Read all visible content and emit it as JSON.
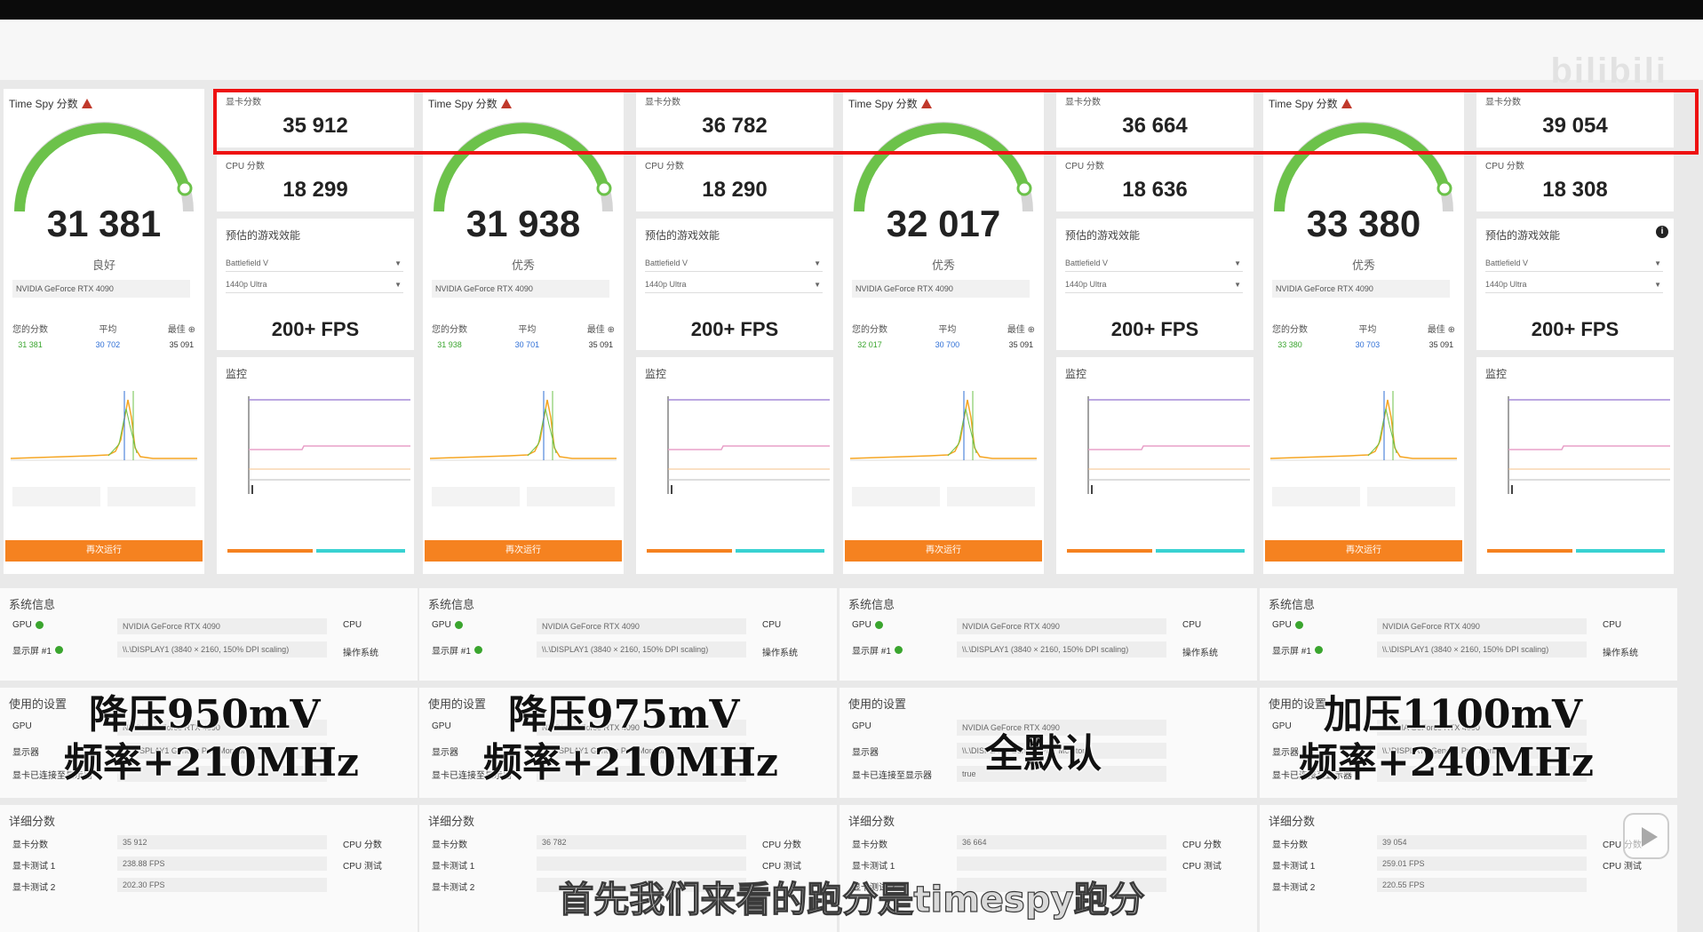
{
  "watermark": "bilibili",
  "gauge_title": "Time Spy 分数",
  "gpu_score_label": "显卡分数",
  "cpu_score_label": "CPU 分数",
  "perf_title": "预估的游戏效能",
  "game": "Battlefield V",
  "resolution": "1440p Ultra",
  "monitor_title": "监控",
  "system_title": "系统信息",
  "used_title": "使用的设置",
  "detail_title": "详细分数",
  "gpu_model": "NVIDIA GeForce RTX 4090",
  "display": "\\\\.\\DISPLAY1 (3840 × 2160, 150% DPI scaling)",
  "monitor_name": "\\\\.\\DISPLAY1 Generic PnP Monitor",
  "compare_label": "您的分数",
  "avg_label": "平均",
  "best_label": "最佳",
  "best_value": "35 091",
  "run_button": "再次运行",
  "columns": [
    {
      "score": "31 381",
      "rating": "良好",
      "yours": "31 381",
      "avg": "30 702",
      "gpu_score": "35 912",
      "cpu_score": "18 299",
      "fps": "200+ FPS",
      "overlay": [
        "降压950mV",
        "频率+210MHz"
      ]
    },
    {
      "score": "31 938",
      "rating": "优秀",
      "yours": "31 938",
      "avg": "30 701",
      "gpu_score": "36 782",
      "cpu_score": "18 290",
      "fps": "200+ FPS",
      "overlay": [
        "降压975mV",
        "频率+210MHz"
      ]
    },
    {
      "score": "32 017",
      "rating": "优秀",
      "yours": "32 017",
      "avg": "30 700",
      "gpu_score": "36 664",
      "cpu_score": "18 636",
      "fps": "200+ FPS",
      "overlay": [
        "全默认"
      ]
    },
    {
      "score": "33 380",
      "rating": "优秀",
      "yours": "33 380",
      "avg": "30 703",
      "gpu_score": "39 054",
      "cpu_score": "18 308",
      "fps": "200+ FPS",
      "overlay": [
        "加压1100mV",
        "频率+240MHz"
      ]
    }
  ],
  "detail_rows": {
    "gpu_score": "显卡分数",
    "test1": "显卡测试 1",
    "test2": "显卡测试 2",
    "cpu_score": "CPU 分数",
    "cpu_test": "CPU 测试"
  },
  "detail_values": [
    {
      "t1": "238.88 FPS",
      "t2": "202.30 FPS"
    },
    {
      "t1": "",
      "t2": ""
    },
    {
      "t1": "",
      "t2": ""
    },
    {
      "t1": "259.01 FPS",
      "t2": "220.55 FPS"
    }
  ],
  "subtitle": "首先我们来看的跑分是timespy跑分"
}
